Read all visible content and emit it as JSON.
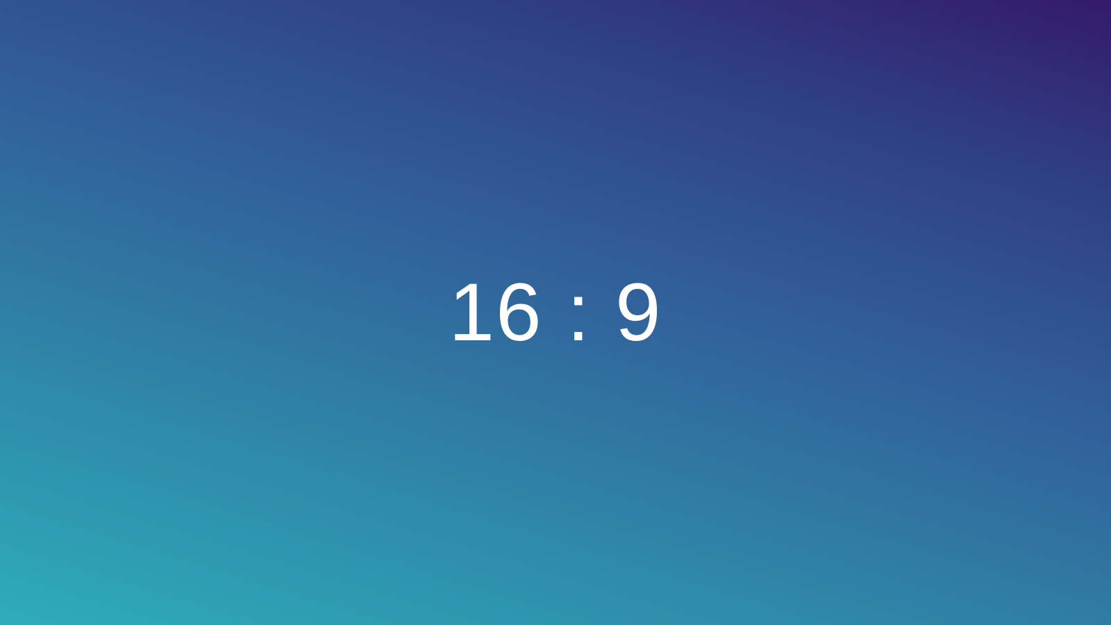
{
  "display": {
    "ratio_text": "16 : 9"
  },
  "colors": {
    "text": "#ffffff",
    "gradient_bottom_left": "#2eacbc",
    "gradient_top_right": "#341a6a"
  }
}
